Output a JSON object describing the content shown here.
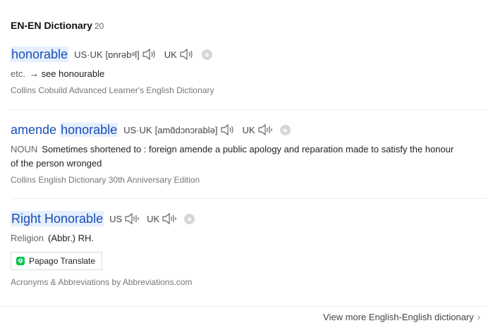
{
  "header": {
    "title": "EN-EN Dictionary",
    "count": "20"
  },
  "entries": [
    {
      "headword": "honorable",
      "us_label": "US·UK",
      "phonetic": "[ɒnrəbᵊl]",
      "uk_label": "UK",
      "pos": "etc.",
      "definition": "→ see honourable",
      "source": "Collins Cobuild Advanced Learner's English Dictionary"
    },
    {
      "headword_part1": "amende",
      "headword_part2": "honorable",
      "us_label": "US·UK",
      "phonetic": "[amɑ̃dɔnɔrablə]",
      "uk_label": "UK",
      "pos": "NOUN",
      "definition": "Sometimes shortened to : foreign amende a public apology and reparation made to satisfy the honour of the person wronged",
      "source": "Collins English Dictionary 30th Anniversary Edition"
    },
    {
      "headword": "Right Honorable",
      "us_label": "US",
      "uk_label": "UK",
      "pos": "Religion",
      "definition": "(Abbr.) RH.",
      "translate_button": "Papago Translate",
      "source": "Acronyms & Abbreviations by Abbreviations.com"
    }
  ],
  "footer": {
    "more_link": "View more English-English dictionary",
    "more_icon": "chevron-right-icon"
  },
  "colors": {
    "headword": "#1a4eb4",
    "highlight": "#e5effd",
    "papago_green": "#00c73c",
    "papago_blue": "#2b7cf2"
  }
}
